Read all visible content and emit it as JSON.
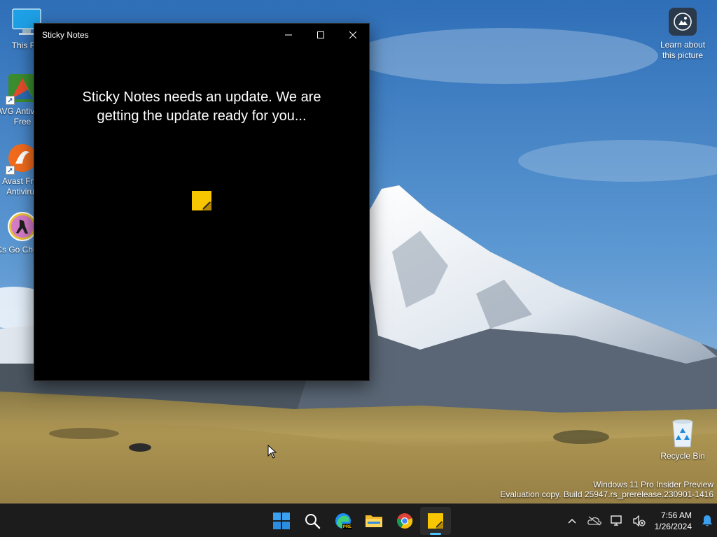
{
  "desktop": {
    "icons": [
      {
        "label": "This PC",
        "icon": "monitor-icon"
      },
      {
        "label": "AVG Antivirus Free",
        "icon": "avg-icon"
      },
      {
        "label": "Avast Free Antivirus",
        "icon": "avast-icon"
      },
      {
        "label": "Cs Go Cheats",
        "icon": "csgo-icon"
      }
    ],
    "learn_about_picture": "Learn about this picture",
    "recycle_bin": "Recycle Bin",
    "watermark_line1": "Windows 11 Pro Insider Preview",
    "watermark_line2": "Evaluation copy. Build 25947.rs_prerelease.230901-1416"
  },
  "window": {
    "title": "Sticky Notes",
    "message": "Sticky Notes needs an update. We are getting the update ready for you...",
    "controls": {
      "minimize": "minimize-icon",
      "maximize": "maximize-icon",
      "close": "close-icon"
    }
  },
  "taskbar": {
    "apps": [
      {
        "name": "Start",
        "icon": "windows-logo-icon"
      },
      {
        "name": "Search",
        "icon": "search-icon"
      },
      {
        "name": "Microsoft Edge Preview",
        "icon": "edge-icon",
        "badge": "PRE"
      },
      {
        "name": "File Explorer",
        "icon": "folder-icon"
      },
      {
        "name": "Google Chrome",
        "icon": "chrome-icon"
      },
      {
        "name": "Sticky Notes",
        "icon": "sticky-notes-icon",
        "active": true
      }
    ],
    "tray": {
      "time": "7:56 AM",
      "date": "1/26/2024"
    }
  },
  "colors": {
    "sticky_yellow": "#f7c600",
    "window_bg": "#000000",
    "taskbar_bg": "#1c1c1c",
    "accent": "#4cc2ff"
  }
}
